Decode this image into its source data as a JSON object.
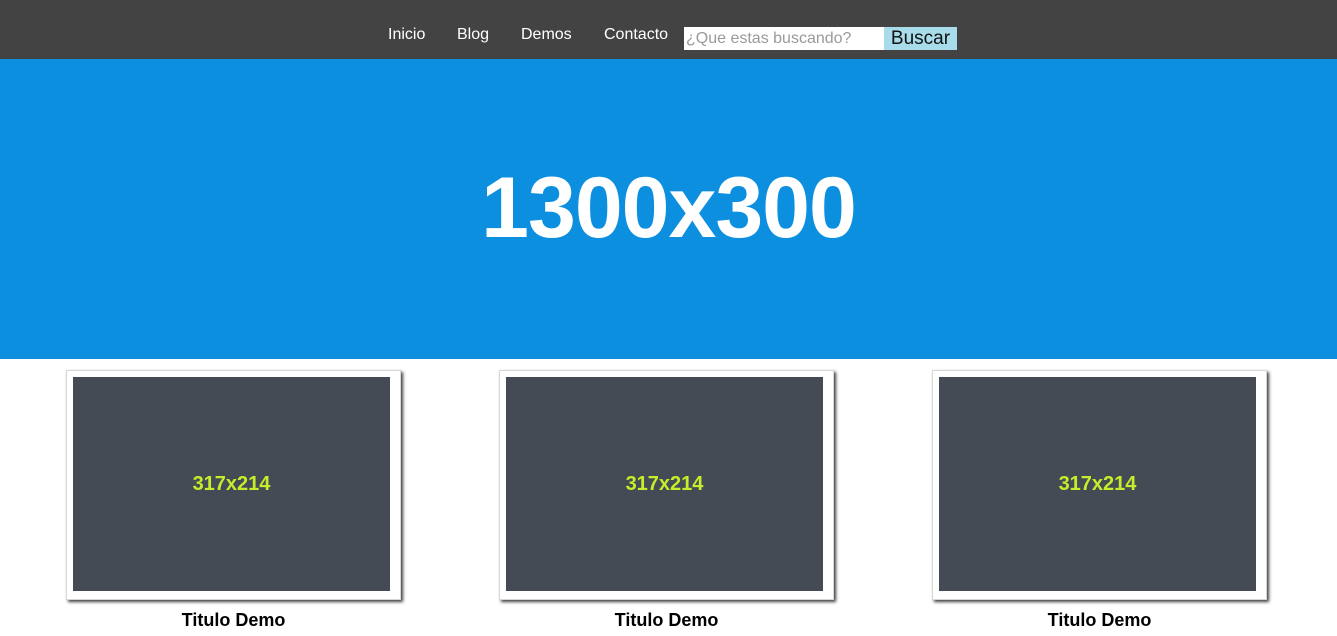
{
  "nav": {
    "items": [
      {
        "label": "Inicio"
      },
      {
        "label": "Blog"
      },
      {
        "label": "Demos"
      },
      {
        "label": "Contacto"
      }
    ]
  },
  "search": {
    "placeholder": "¿Que estas buscando?",
    "value": "",
    "button_label": "Buscar"
  },
  "hero": {
    "text": "1300x300",
    "background_color": "#0d8fdf"
  },
  "cards": [
    {
      "image_label": "317x214",
      "title": "Titulo Demo"
    },
    {
      "image_label": "317x214",
      "title": "Titulo Demo"
    },
    {
      "image_label": "317x214",
      "title": "Titulo Demo"
    }
  ],
  "colors": {
    "topbar": "#434343",
    "search_button": "#a9dcea",
    "placeholder_image": "#454b54",
    "placeholder_text": "#c6ec2b"
  }
}
